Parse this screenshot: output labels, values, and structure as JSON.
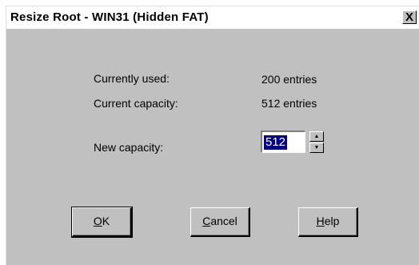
{
  "window": {
    "title": "Resize Root - WIN31 (Hidden FAT)",
    "close_label": "X"
  },
  "fields": {
    "currently_used_label": "Currently used:",
    "currently_used_value": "200 entries",
    "current_capacity_label": "Current capacity:",
    "current_capacity_value": "512 entries",
    "new_capacity_label": "New capacity:",
    "new_capacity_value": "512"
  },
  "buttons": {
    "ok": {
      "mnemonic": "O",
      "rest": "K"
    },
    "cancel": {
      "mnemonic": "C",
      "rest": "ancel"
    },
    "help": {
      "mnemonic": "H",
      "rest": "elp"
    }
  },
  "icons": {
    "up": "arrow-up-icon",
    "down": "arrow-down-icon"
  }
}
